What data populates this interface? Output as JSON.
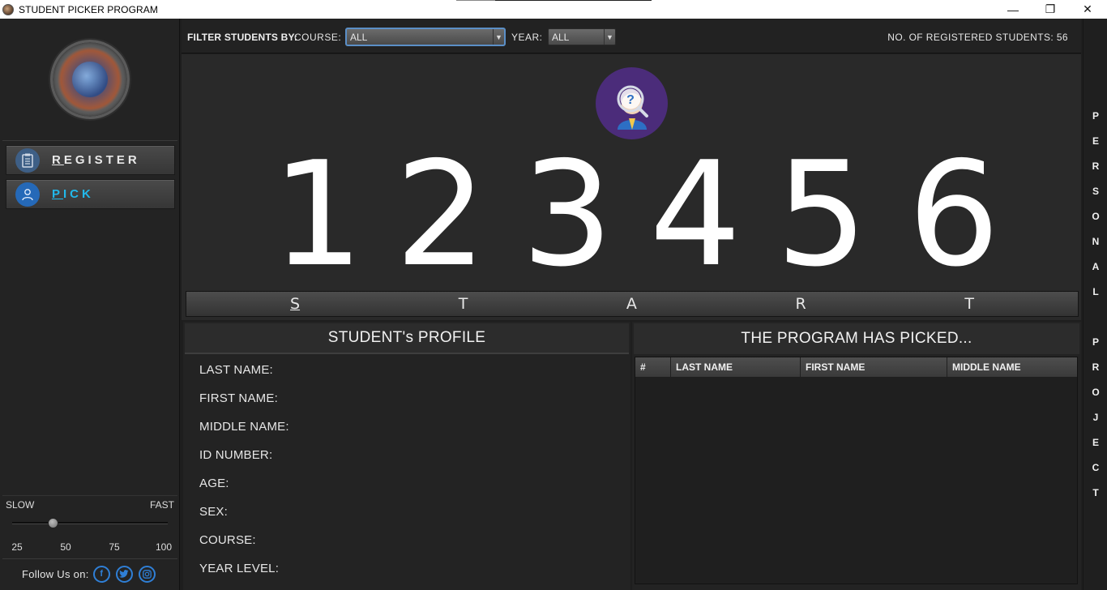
{
  "window": {
    "title": "STUDENT PICKER PROGRAM",
    "minimize_glyph": "—",
    "maximize_glyph": "❐",
    "close_glyph": "✕"
  },
  "sidebar": {
    "register_label_first": "R",
    "register_label_rest": "EGISTER",
    "pick_label_first": "P",
    "pick_label_rest": "ICK",
    "speed": {
      "slow_label": "SLOW",
      "fast_label": "FAST",
      "ticks": [
        "25",
        "50",
        "75",
        "100"
      ],
      "min": 25,
      "max": 100,
      "value": 37
    },
    "follow_label": "Follow Us on:",
    "social_icons": [
      "facebook-icon",
      "twitter-icon",
      "instagram-icon"
    ]
  },
  "filter": {
    "title": "FILTER STUDENTS BY:",
    "course_label": "COURSE:",
    "course_value": "ALL",
    "year_label": "YEAR:",
    "year_value": "ALL",
    "count_label": "NO. OF REGISTERED STUDENTS: 56"
  },
  "picker": {
    "digits": [
      "1",
      "2",
      "3",
      "4",
      "5",
      "6"
    ],
    "start_letters": [
      "S",
      "T",
      "A",
      "R",
      "T"
    ]
  },
  "profile": {
    "title": "STUDENT's PROFILE",
    "fields": [
      "LAST NAME:",
      "FIRST NAME:",
      "MIDDLE NAME:",
      "ID NUMBER:",
      "AGE:",
      "SEX:",
      "COURSE:",
      "YEAR LEVEL:"
    ]
  },
  "picked": {
    "title": "THE PROGRAM HAS PICKED...",
    "columns": [
      "#",
      "LAST NAME",
      "FIRST NAME",
      "MIDDLE NAME"
    ],
    "rows": []
  },
  "vertical_strip": [
    "P",
    "E",
    "R",
    "S",
    "O",
    "N",
    "A",
    "L",
    "",
    "P",
    "R",
    "O",
    "J",
    "E",
    "C",
    "T"
  ],
  "colors": {
    "accent_blue": "#22b8ea",
    "background": "#1e1e1e",
    "panel": "#292929",
    "picker_icon": "#4b2c7a",
    "social": "#2f7fd6"
  }
}
